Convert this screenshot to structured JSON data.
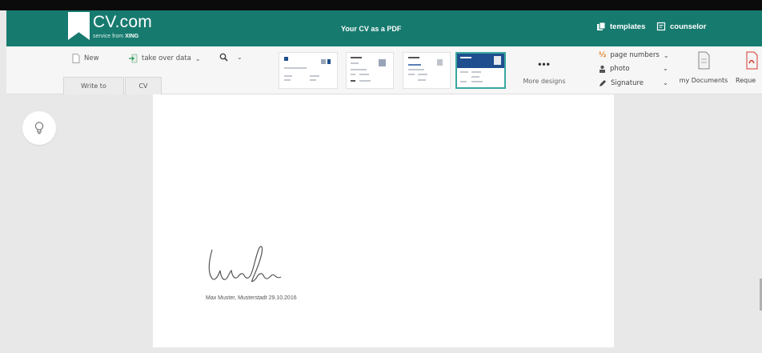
{
  "header": {
    "logo_title": "CV.com",
    "logo_sub_prefix": "service from",
    "logo_sub_brand": "XING",
    "center_title": "Your CV as a PDF",
    "templates_label": "templates",
    "counselor_label": "counselor",
    "background_color": "#177a6f"
  },
  "toolbar": {
    "new_label": "New",
    "take_over_label": "take over data",
    "zoom_icon": "magnifier-icon",
    "tabs": [
      {
        "label": "Write to"
      },
      {
        "label": "CV"
      }
    ],
    "more_dots": "•••",
    "more_label": "More designs",
    "options": {
      "page_numbers_label": "page numbers",
      "photo_label": "photo",
      "signature_label": "Signature"
    },
    "my_documents_label": "my Documents",
    "request_label": "Reque"
  },
  "document": {
    "signature_caption": "Max Muster, Musterstadt 29.10.2016"
  },
  "sidebar": {
    "tip_icon": "lightbulb-icon"
  },
  "colors": {
    "accent": "#177a6f",
    "selected_thumb_border": "#3aa7a0"
  }
}
